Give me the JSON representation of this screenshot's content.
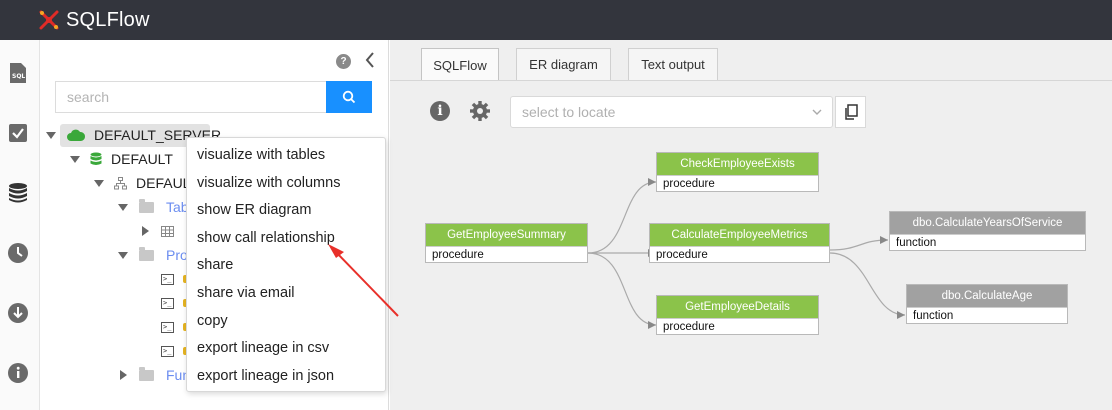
{
  "app": {
    "title": "SQLFlow"
  },
  "tree_panel": {
    "search_placeholder": "search",
    "help_glyph": "?",
    "rows": {
      "server": "DEFAULT_SERVER",
      "database": "DEFAULT",
      "schema": "DEFAULT",
      "tables_folder": "Tabl",
      "procedures_folder": "Proc",
      "functions_folder": "Func"
    }
  },
  "context_menu": {
    "items": [
      "visualize with tables",
      "visualize with columns",
      "show ER diagram",
      "show call relationship",
      "share",
      "share via email",
      "copy",
      "export lineage in csv",
      "export lineage in json"
    ]
  },
  "tabs": [
    {
      "label": "SQLFlow",
      "active": true
    },
    {
      "label": "ER diagram",
      "active": false
    },
    {
      "label": "Text output",
      "active": false
    }
  ],
  "toolbar": {
    "info_glyph": "i",
    "locate_placeholder": "select to locate"
  },
  "graph": {
    "nodes": [
      {
        "name": "GetEmployeeSummary",
        "type": "procedure",
        "color": "green"
      },
      {
        "name": "CheckEmployeeExists",
        "type": "procedure",
        "color": "green"
      },
      {
        "name": "CalculateEmployeeMetrics",
        "type": "procedure",
        "color": "green"
      },
      {
        "name": "GetEmployeeDetails",
        "type": "procedure",
        "color": "green"
      },
      {
        "name": "dbo.CalculateYearsOfService",
        "type": "function",
        "color": "gray"
      },
      {
        "name": "dbo.CalculateAge",
        "type": "function",
        "color": "gray"
      }
    ]
  },
  "colors": {
    "topbar": "#33353d",
    "accent_blue": "#1890ff",
    "node_green": "#8bc34a",
    "node_gray": "#a1a1a1",
    "annotation_red": "#e8302a"
  }
}
